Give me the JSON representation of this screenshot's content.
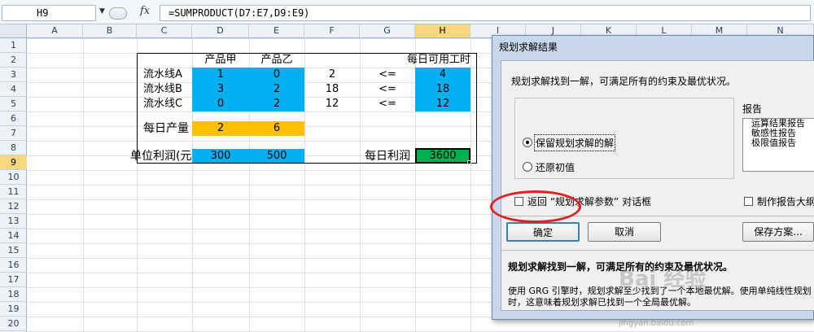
{
  "formula_bar": {
    "name_box": "H9",
    "fx_label": "fx",
    "formula": "=SUMPRODUCT(D7:E7,D9:E9)"
  },
  "columns": [
    "A",
    "B",
    "C",
    "D",
    "E",
    "F",
    "G",
    "H",
    "I",
    "J",
    "K",
    "L",
    "M",
    "N"
  ],
  "rows": [
    "1",
    "2",
    "3",
    "4",
    "5",
    "6",
    "7",
    "8",
    "9",
    "10",
    "11",
    "12",
    "13",
    "14",
    "15",
    "16",
    "17",
    "18",
    "19",
    "20"
  ],
  "sheet": {
    "d2": "产品甲",
    "e2": "产品乙",
    "h2": "每日可用工时",
    "c3": "流水线A",
    "d3": "1",
    "e3": "0",
    "f3": "2",
    "g3": "<=",
    "h3": "4",
    "c4": "流水线B",
    "d4": "3",
    "e4": "2",
    "f4": "18",
    "g4": "<=",
    "h4": "18",
    "c5": "流水线C",
    "d5": "0",
    "e5": "2",
    "f5": "12",
    "g5": "<=",
    "h5": "12",
    "c7": "每日产量",
    "d7": "2",
    "e7": "6",
    "c9": "单位利润(元",
    "d9": "300",
    "e9": "500",
    "g9": "每日利润",
    "h9": "3600"
  },
  "colors": {
    "constraint_fill": "#00b0f0",
    "variable_fill": "#ffc000",
    "objective_fill": "#00b050",
    "highlight_circle": "#e32020"
  },
  "dialog": {
    "title": "规划求解结果",
    "found_message": "规划求解找到一解，可满足所有的约束及最优状况。",
    "option_keep": "保留规划求解的解",
    "option_restore": "还原初值",
    "report_label": "报告",
    "reports": [
      "运算结果报告",
      "敏感性报告",
      "极限值报告"
    ],
    "return_checkbox": "返回 “规划求解参数” 对话框",
    "outline_checkbox": "制作报告大纲",
    "ok_button": "确定",
    "cancel_button": "取消",
    "save_scenario_button": "保存方案...",
    "status_bold": "规划求解找到一解，可满足所有的约束及最优状况。",
    "status_detail_1": "使用 GRG 引擎时，规划求解至少找到了一个本地最优解。使用单纯线性规划",
    "status_detail_2": "时，这意味着规划求解已找到一个全局最优解。"
  },
  "watermark": {
    "text": "Bai 经验",
    "url": "jingyan.baidu.com"
  }
}
